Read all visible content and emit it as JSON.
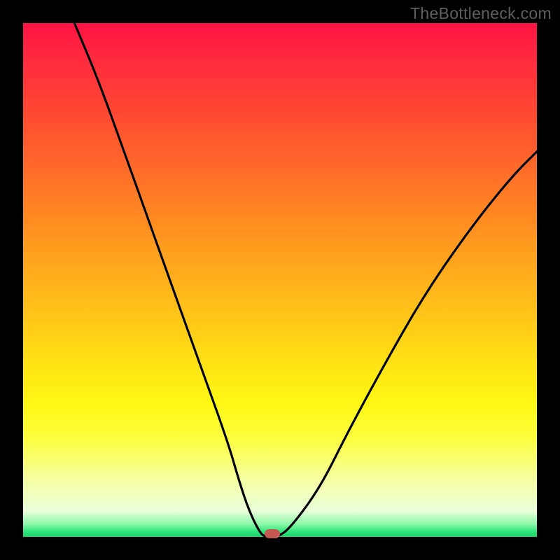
{
  "watermark": "TheBottleneck.com",
  "chart_data": {
    "type": "line",
    "title": "",
    "xlabel": "",
    "ylabel": "",
    "xlim": [
      0,
      100
    ],
    "ylim": [
      0,
      100
    ],
    "grid": false,
    "legend": false,
    "series": [
      {
        "name": "curve",
        "x": [
          10,
          15,
          20,
          25,
          30,
          35,
          40,
          42,
          44,
          46,
          47,
          50,
          53,
          58,
          63,
          70,
          78,
          87,
          95,
          100
        ],
        "y": [
          100,
          88,
          74,
          60,
          46,
          32,
          18,
          11,
          5,
          1,
          0,
          0,
          3,
          10,
          20,
          33,
          47,
          60,
          70,
          75
        ],
        "color": "#000000"
      }
    ],
    "marker": {
      "x": 48.5,
      "y": 0,
      "color": "#c55952"
    },
    "background_gradient": {
      "direction": "top-to-bottom",
      "stops": [
        {
          "pos": 0,
          "color": "#ff1444"
        },
        {
          "pos": 0.5,
          "color": "#ffaa1c"
        },
        {
          "pos": 0.75,
          "color": "#fff814"
        },
        {
          "pos": 0.95,
          "color": "#e9ffda"
        },
        {
          "pos": 1,
          "color": "#19d468"
        }
      ]
    }
  }
}
